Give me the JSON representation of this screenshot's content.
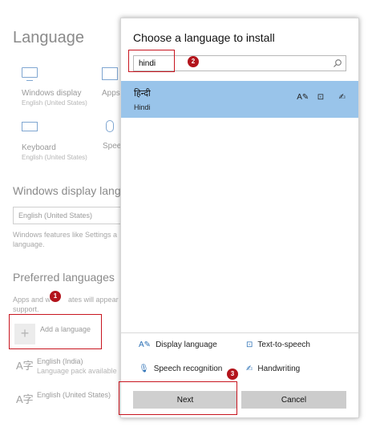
{
  "settings": {
    "title": "Language",
    "tiles": [
      {
        "main": "Windows display",
        "sub": "English (United States)",
        "icon": "monitor-icon"
      },
      {
        "main": "Apps",
        "sub": "",
        "icon": "apps-icon"
      },
      {
        "main": "Keyboard",
        "sub": "English (United States)",
        "icon": "keyboard-icon"
      },
      {
        "main": "Speech",
        "sub": "",
        "icon": "microphone-icon"
      }
    ],
    "display_section": {
      "heading": "Windows display langu",
      "selected": "English (United States)",
      "note_line1": "Windows features like Settings a",
      "note_line2": "language."
    },
    "preferred_section": {
      "heading": "Preferred languages",
      "note_prefix": "Apps and w",
      "note_suffix": "ates will appear in",
      "note_line2": "support.",
      "add_label": "Add a language",
      "add_symbol": "+",
      "languages": [
        {
          "name": "English (India)",
          "sub": "Language pack available",
          "glyph": "A字"
        },
        {
          "name": "English (United States)",
          "sub": "",
          "glyph": "A字"
        }
      ]
    }
  },
  "dialog": {
    "title": "Choose a language to install",
    "search": {
      "value": "hindi",
      "placeholder": ""
    },
    "result": {
      "native": "हिन्दी",
      "english": "Hindi",
      "icons": [
        "A✎",
        "⊡",
        "✍"
      ]
    },
    "features": [
      {
        "label": "Display language",
        "icon": "A✎"
      },
      {
        "label": "Text-to-speech",
        "icon": "⊡"
      },
      {
        "label": "Speech recognition",
        "icon": "🎙"
      },
      {
        "label": "Handwriting",
        "icon": "✍"
      }
    ],
    "buttons": {
      "next": "Next",
      "cancel": "Cancel"
    }
  },
  "annotations": {
    "step1": "1",
    "step2": "2",
    "step3": "3"
  },
  "colors": {
    "accent": "#2a6fb5",
    "highlight": "#99c4ea",
    "annotation": "#c8151f"
  }
}
